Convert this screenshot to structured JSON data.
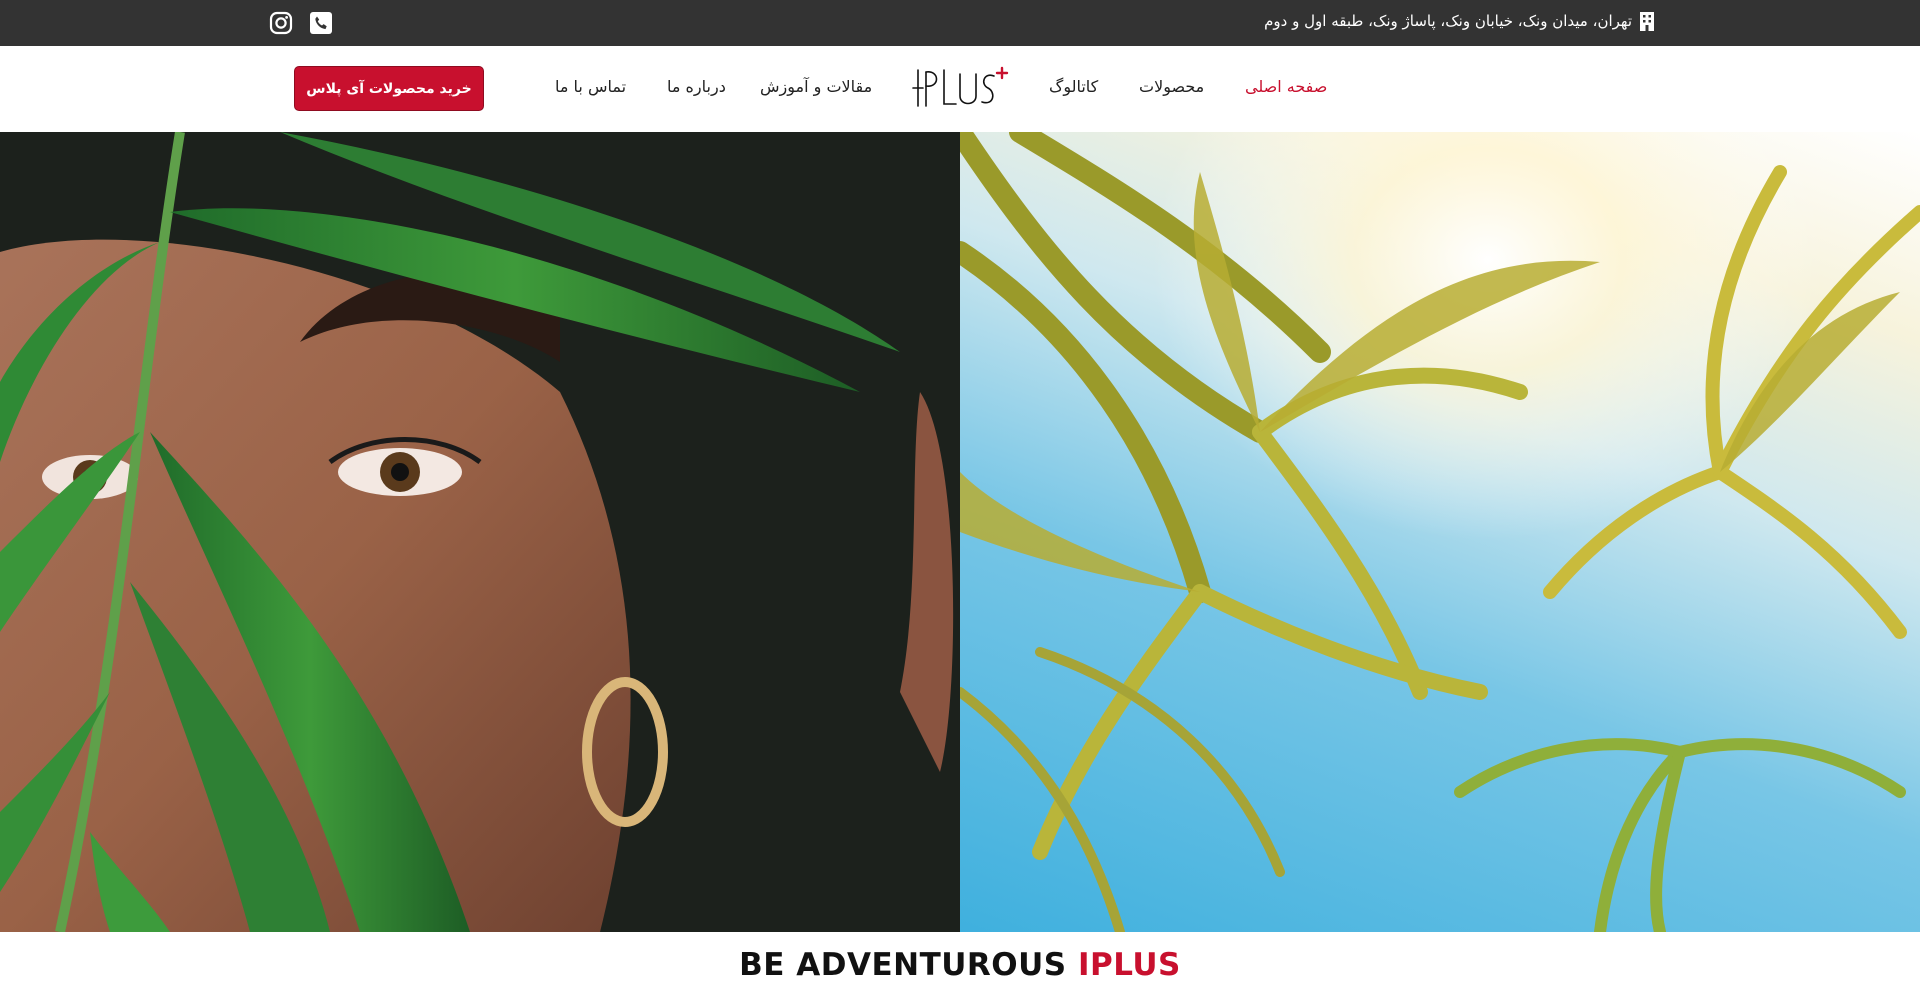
{
  "topbar": {
    "address": "تهران، میدان ونک، خیابان ونک، پاساژ ونک، طبقه اول و دوم",
    "icons": [
      "instagram-icon",
      "phone-icon",
      "building-icon"
    ]
  },
  "nav": {
    "cta_label": "خرید محصولات آی پلاس",
    "items": [
      {
        "label": "صفحه اصلی",
        "active": true
      },
      {
        "label": "محصولات",
        "active": false
      },
      {
        "label": "کاتالوگ",
        "active": false
      },
      {
        "label": "مقالات و آموزش",
        "active": false
      },
      {
        "label": "درباره ما",
        "active": false
      },
      {
        "label": "تماس با ما",
        "active": false
      }
    ],
    "logo_text": "IPLUS"
  },
  "hero": {
    "headline_main": "BE ADVENTUROUS",
    "headline_brand": "IPLUS"
  },
  "colors": {
    "accent": "#c8102e",
    "topbar_bg": "#333333"
  }
}
